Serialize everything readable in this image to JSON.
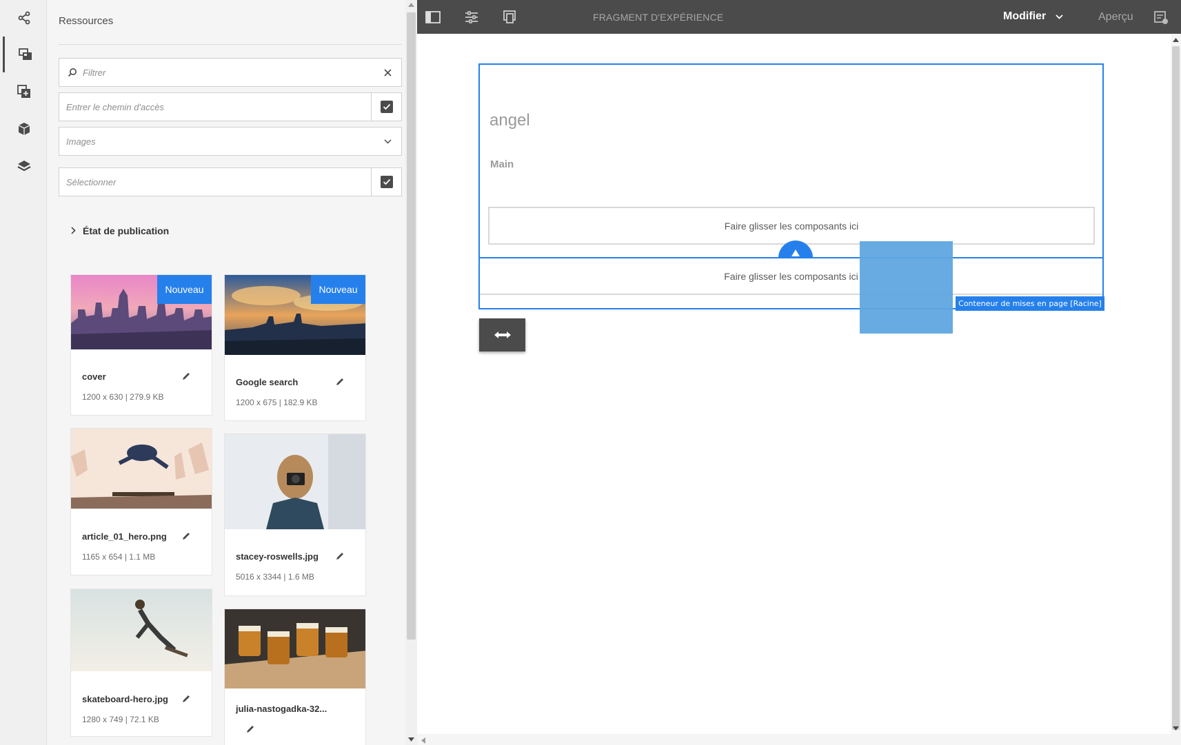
{
  "rail": {
    "items": [
      "share-icon",
      "assets-icon",
      "components-icon",
      "box-icon",
      "layers-icon"
    ]
  },
  "panel": {
    "title": "Ressources",
    "filter_placeholder": "Filtrer",
    "path_placeholder": "Entrer le chemin d'accès",
    "type_value": "Images",
    "select_placeholder": "Sélectionner",
    "publication_label": "État de publication"
  },
  "assets": [
    {
      "name": "cover",
      "meta": "1200 x 630 | 279.9 KB",
      "badge": "Nouveau"
    },
    {
      "name": "Google search",
      "meta": "1200 x 675 | 182.9 KB",
      "badge": "Nouveau"
    },
    {
      "name": "article_01_hero.png",
      "meta": "1165 x 654 | 1.1 MB",
      "badge": ""
    },
    {
      "name": "stacey-roswells.jpg",
      "meta": "5016 x 3344 | 1.6 MB",
      "badge": ""
    },
    {
      "name": "skateboard-hero.jpg",
      "meta": "1280 x 749 | 72.1 KB",
      "badge": ""
    },
    {
      "name": "julia-nastogadka-32...",
      "meta": "",
      "badge": ""
    }
  ],
  "toolbar": {
    "title": "FRAGMENT D'EXPÉRIENCE",
    "mode": "Modifier",
    "preview": "Aperçu"
  },
  "canvas": {
    "heading": "angel",
    "section": "Main",
    "drop_text_1": "Faire glisser les composants ici",
    "drop_text_2": "Faire glisser les composants ici",
    "container_label": "Conteneur de mises en page [Racine]"
  },
  "colors": {
    "accent": "#2680eb",
    "toolbar": "#4b4b4b"
  }
}
